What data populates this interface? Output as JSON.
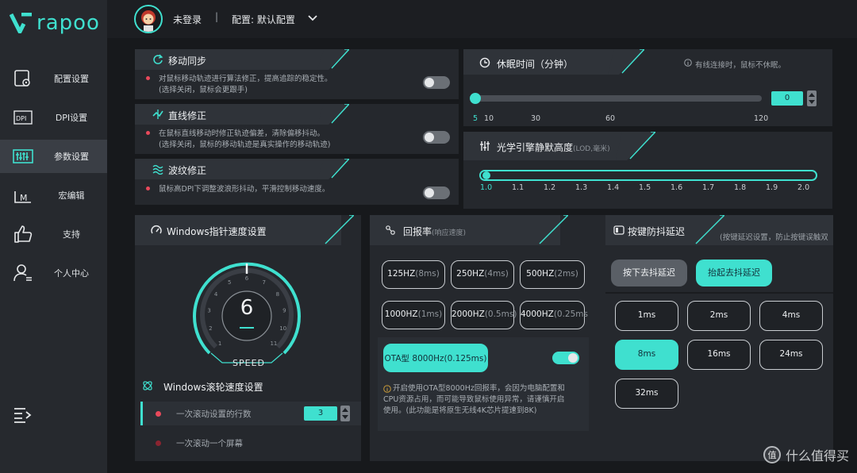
{
  "brand": {
    "name": "rapoo",
    "accent": "#3fe0cf"
  },
  "sidebar": {
    "items": [
      {
        "label": "配置设置",
        "icon": "settings-doc-icon"
      },
      {
        "label": "DPI设置",
        "icon": "dpi-icon"
      },
      {
        "label": "参数设置",
        "icon": "equalizer-icon",
        "active": true
      },
      {
        "label": "宏编辑",
        "icon": "macro-icon"
      },
      {
        "label": "支持",
        "icon": "thumbs-up-icon"
      },
      {
        "label": "个人中心",
        "icon": "user-icon"
      }
    ],
    "collapse_icon": "menu-collapse-icon"
  },
  "topbar": {
    "user": "未登录",
    "separator": "|",
    "profile": "配置: 默认配置"
  },
  "motion_sync": {
    "title": "移动同步",
    "desc1": "对鼠标移动轨迹进行算法修正，提高追踪的稳定性。",
    "desc2": "(选择关闭，鼠标会更跟手)",
    "enabled": false
  },
  "angle_snap": {
    "title": "直线修正",
    "desc1": "在鼠标直线移动时修正轨迹偏差，清除偏移抖动。",
    "desc2": "(选择关闭，鼠标的移动轨迹是真实操作的移动轨迹)",
    "enabled": false
  },
  "ripple": {
    "title": "波纹修正",
    "desc1": "鼠标高DPI下调整波浪形抖动，平滑控制移动速度。",
    "enabled": false
  },
  "sleep": {
    "title": "休眠时间（分钟）",
    "hint": "有线连接时，鼠标不休眠。",
    "value": "0",
    "ticks": [
      "5",
      "10",
      "30",
      "60",
      "120"
    ]
  },
  "lod": {
    "title": "光学引擎静默高度",
    "unit": "(LOD,毫米)",
    "ticks": [
      "1.0",
      "1.1",
      "1.2",
      "1.3",
      "1.4",
      "1.5",
      "1.6",
      "1.7",
      "1.8",
      "1.9",
      "2.0"
    ],
    "value": 1.0
  },
  "pointer": {
    "title": "Windows指针速度设置",
    "value": "6",
    "label": "SPEED",
    "dial_ticks": [
      "1",
      "2",
      "3",
      "4",
      "5",
      "6",
      "7",
      "8",
      "9",
      "10",
      "11"
    ]
  },
  "scroll": {
    "title": "Windows滚轮速度设置",
    "option1": "一次滚动设置的行数",
    "lines": "3",
    "option2": "一次滚动一个屏幕"
  },
  "polling": {
    "title": "回报率",
    "subtitle": "(响应速度)",
    "rates": [
      {
        "main": "125HZ",
        "unit": "(8ms)"
      },
      {
        "main": "250HZ",
        "unit": "(4ms)"
      },
      {
        "main": "500HZ",
        "unit": "(2ms)"
      },
      {
        "main": "1000HZ",
        "unit": "(1ms)"
      },
      {
        "main": "2000HZ",
        "unit": "(0.5ms)"
      },
      {
        "main": "4000HZ",
        "unit": "(0.25ms"
      }
    ],
    "ota": "OTA型 8000Hz(0.125ms)",
    "ota_enabled": true,
    "note1": "开启使用OTA型8000Hz回报率，会因为电脑配置和",
    "note2": "CPU资源占用，而可能导致鼠标使用异常，请谨慎开启",
    "note3": "使用。(此功能是将原生无线4K芯片提速到8K)"
  },
  "debounce": {
    "title": "按键防抖延迟",
    "hint": "(按键延迟设置，防止按键误触双",
    "press_label": "按下去抖延迟",
    "release_label": "抬起去抖延迟",
    "options": [
      "1ms",
      "2ms",
      "4ms",
      "8ms",
      "16ms",
      "24ms",
      "32ms"
    ],
    "selected": "8ms"
  },
  "watermark": {
    "icon_text": "值",
    "text": "什么值得买"
  }
}
